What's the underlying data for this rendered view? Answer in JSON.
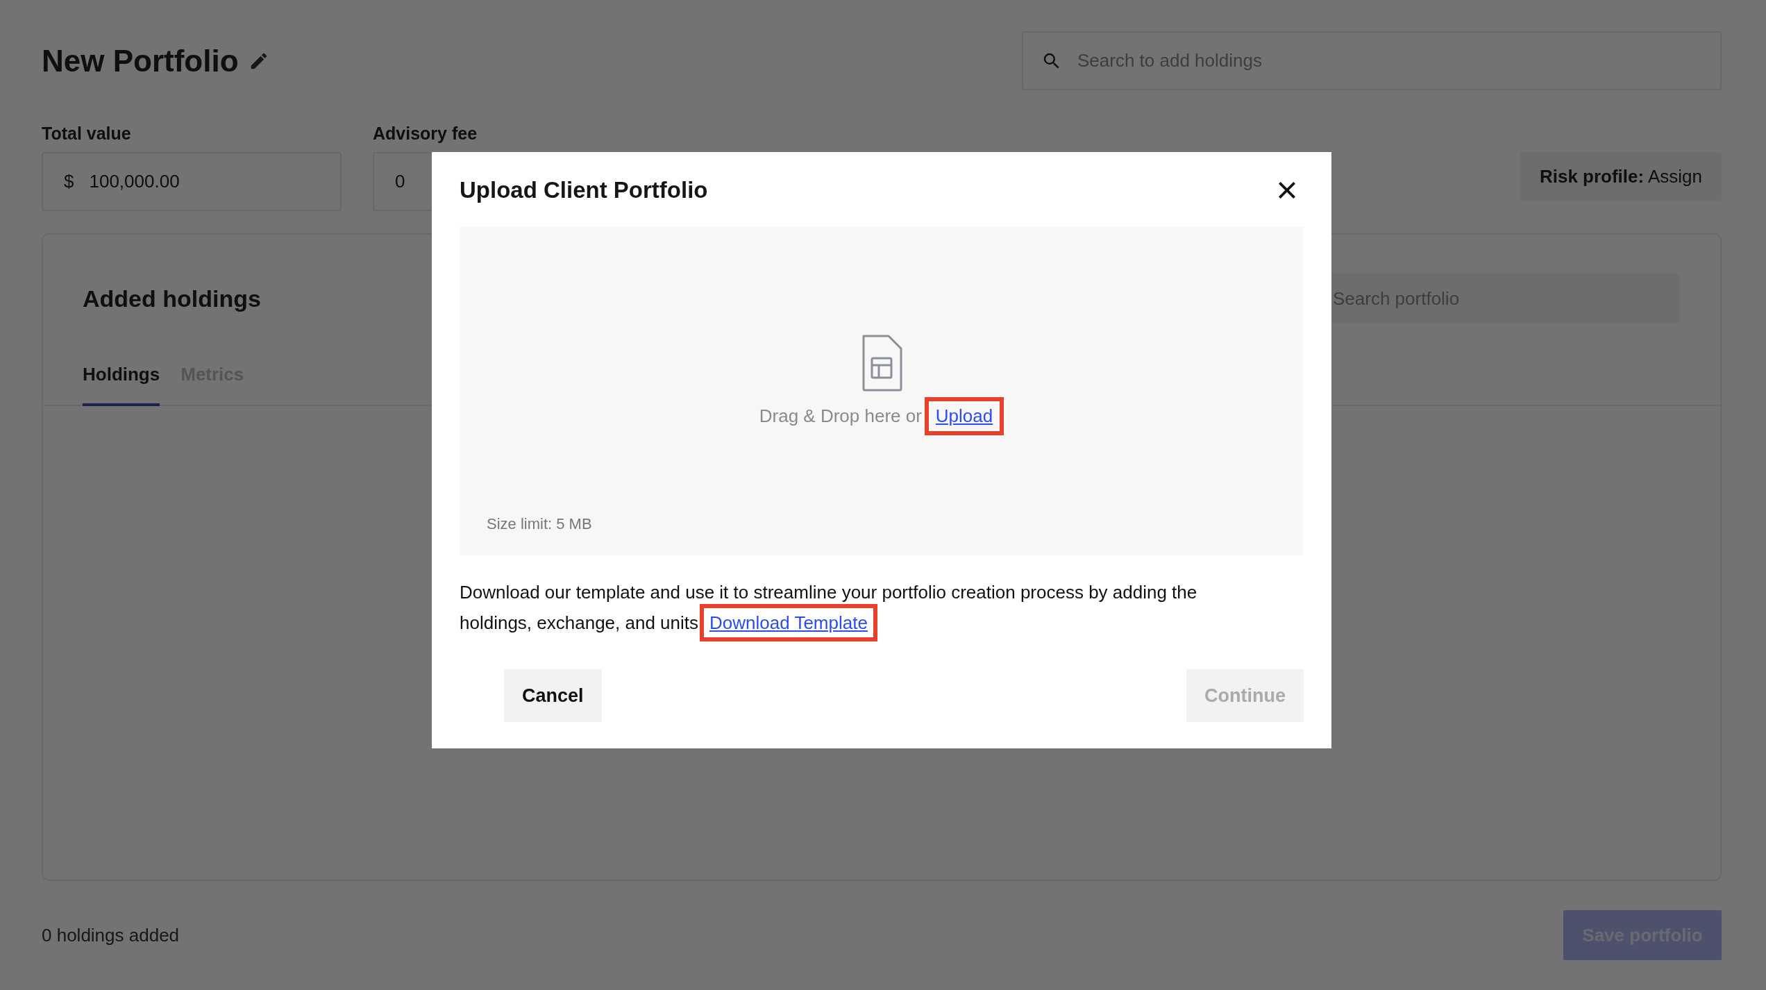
{
  "page": {
    "title": "New Portfolio",
    "search": {
      "placeholder": "Search to add holdings"
    },
    "fields": [
      {
        "label": "Total value",
        "prefix": "$",
        "value": "100,000.00"
      },
      {
        "label": "Advisory fee",
        "value": "0"
      }
    ],
    "risk_profile": {
      "label": "Risk profile:",
      "value": "Assign"
    },
    "holdings": {
      "title": "Added holdings",
      "search": {
        "placeholder": "Search portfolio"
      },
      "tabs": [
        {
          "label": "Holdings",
          "selected": true
        },
        {
          "label": "Metrics",
          "selected": false
        }
      ]
    },
    "footer": {
      "count": "0 holdings added",
      "save_button": {
        "label": "Save portfolio",
        "disabled": true
      }
    }
  },
  "dialog": {
    "title": "Upload Client Portfolio",
    "dropzone": {
      "prompt": "Drag & Drop here or",
      "link": {
        "label": "Upload",
        "highlighted": true
      },
      "size_limit": "Size limit: 5 MB"
    },
    "description": "Download our template and use it to streamline your portfolio creation process by adding the holdings, exchange, and units",
    "template_link": {
      "label": "Download Template",
      "highlighted": true
    },
    "buttons": [
      {
        "label": "Cancel",
        "disabled": false
      },
      {
        "label": "Continue",
        "disabled": true
      }
    ]
  }
}
